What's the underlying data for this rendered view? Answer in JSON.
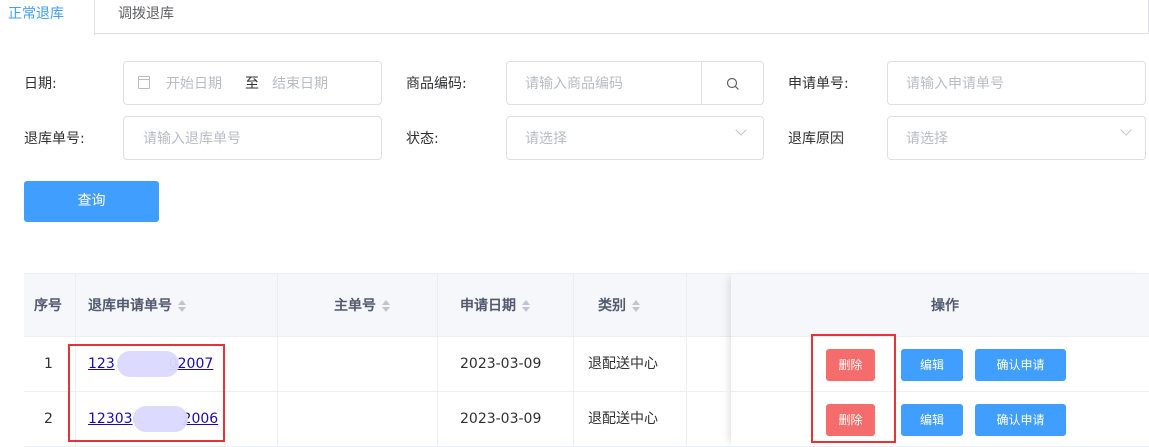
{
  "tabs": [
    {
      "label": "正常退库",
      "active": true
    },
    {
      "label": "调拨退库",
      "active": false
    }
  ],
  "filters": {
    "date_label": "日期:",
    "date_start_placeholder": "开始日期",
    "date_separator": "至",
    "date_end_placeholder": "结束日期",
    "product_code_label": "商品编码:",
    "product_code_placeholder": "请输入商品编码",
    "apply_no_label": "申请单号:",
    "apply_no_placeholder": "请输入申请单号",
    "return_no_label": "退库单号:",
    "return_no_placeholder": "请输入退库单号",
    "status_label": "状态:",
    "status_placeholder": "请选择",
    "reason_label": "退库原因",
    "reason_placeholder": "请选择",
    "query_button": "查询"
  },
  "table": {
    "columns": [
      "序号",
      "退库申请单号",
      "主单号",
      "申请日期",
      "类别",
      "操作"
    ],
    "rows": [
      {
        "index": "1",
        "apply_no_start": "123",
        "apply_no_end": "02007",
        "main_no": "",
        "date": "2023-03-09",
        "category": "退配送中心"
      },
      {
        "index": "2",
        "apply_no_start": "12303",
        "apply_no_end": "2006",
        "main_no": "",
        "date": "2023-03-09",
        "category": "退配送中心"
      }
    ],
    "actions": {
      "delete": "删除",
      "edit": "编辑",
      "confirm": "确认申请"
    }
  },
  "colors": {
    "accent": "#409eff",
    "danger": "#f56c6c",
    "highlight": "#e8323a"
  }
}
